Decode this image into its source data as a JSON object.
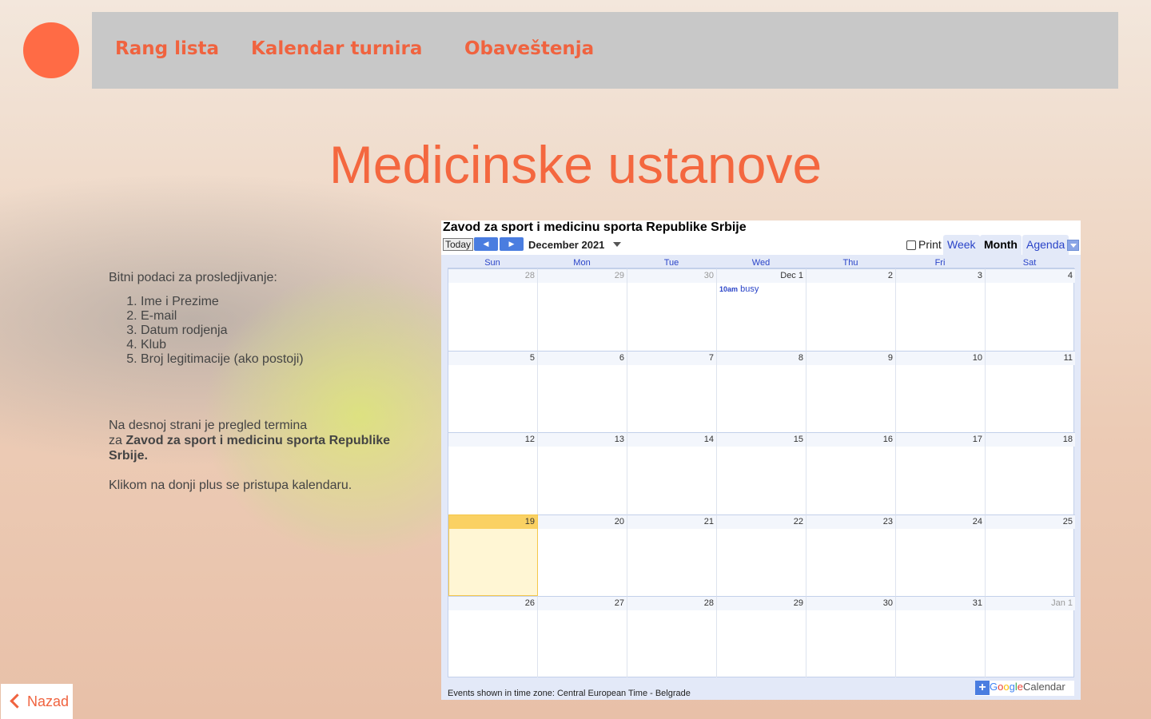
{
  "nav": {
    "items": [
      {
        "label": "Rang lista"
      },
      {
        "label": "Kalendar turnira"
      },
      {
        "label": "Obaveštenja"
      }
    ]
  },
  "page": {
    "title": "Medicinske ustanove"
  },
  "info": {
    "intro": "Bitni podaci za prosledjivanje:",
    "list": [
      "Ime i Prezime",
      "E-mail",
      "Datum rodjenja",
      "Klub",
      "Broj legitimacije (ako postoji)"
    ],
    "p2_prefix": "Na desnoj strani je pregled termina",
    "p2_mid": "za ",
    "p2_bold": "Zavod za sport i medicinu sporta Republike Srbije.",
    "p3": "Klikom na donji plus se pristupa kalendaru."
  },
  "calendar": {
    "title": "Zavod za sport i medicinu sporta Republike Srbije",
    "today_label": "Today",
    "prev_icon": "triangle-left-icon",
    "next_icon": "triangle-right-icon",
    "month_label": "December 2021",
    "print_label": "Print",
    "tabs": [
      "Week",
      "Month",
      "Agenda"
    ],
    "active_tab": "Month",
    "days_of_week": [
      "Sun",
      "Mon",
      "Tue",
      "Wed",
      "Thu",
      "Fri",
      "Sat"
    ],
    "weeks": [
      [
        {
          "d": "28",
          "other": true
        },
        {
          "d": "29",
          "other": true
        },
        {
          "d": "30",
          "other": true
        },
        {
          "d": "Dec 1",
          "event_time": "10am",
          "event_title": "busy"
        },
        {
          "d": "2"
        },
        {
          "d": "3"
        },
        {
          "d": "4"
        }
      ],
      [
        {
          "d": "5"
        },
        {
          "d": "6"
        },
        {
          "d": "7"
        },
        {
          "d": "8"
        },
        {
          "d": "9"
        },
        {
          "d": "10"
        },
        {
          "d": "11"
        }
      ],
      [
        {
          "d": "12"
        },
        {
          "d": "13"
        },
        {
          "d": "14"
        },
        {
          "d": "15"
        },
        {
          "d": "16"
        },
        {
          "d": "17"
        },
        {
          "d": "18"
        }
      ],
      [
        {
          "d": "19",
          "today": true
        },
        {
          "d": "20"
        },
        {
          "d": "21"
        },
        {
          "d": "22"
        },
        {
          "d": "23"
        },
        {
          "d": "24"
        },
        {
          "d": "25"
        }
      ],
      [
        {
          "d": "26"
        },
        {
          "d": "27"
        },
        {
          "d": "28"
        },
        {
          "d": "29"
        },
        {
          "d": "30"
        },
        {
          "d": "31"
        },
        {
          "d": "Jan 1",
          "other": true
        }
      ]
    ],
    "footer": "Events shown in time zone: Central European Time - Belgrade",
    "gcal_badge": {
      "plus": "+",
      "google": "Google",
      "calendar": "Calendar"
    }
  },
  "back": {
    "label": "Nazad",
    "icon": "chevron-left-icon"
  },
  "colors": {
    "accent": "#f0633f",
    "nav_bg": "#c8c8c8",
    "today_bg": "#fff6d4",
    "calendar_link": "#2a44c8"
  }
}
